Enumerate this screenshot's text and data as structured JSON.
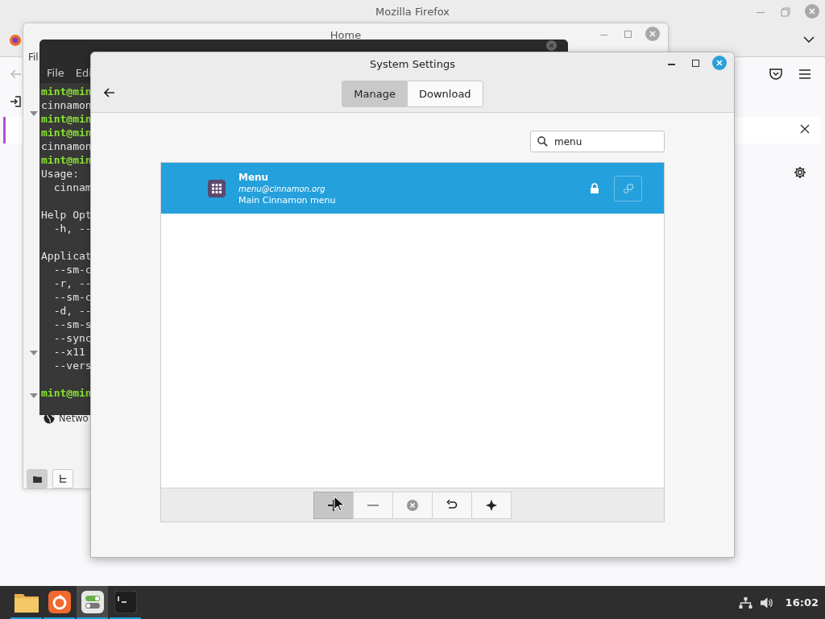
{
  "firefox": {
    "title": "Mozilla Firefox"
  },
  "files_window": {
    "title": "Home",
    "menu": [
      "Fil"
    ],
    "sidebar": [
      {
        "label": "Netwo"
      }
    ],
    "view_buttons": [
      {
        "kind": "icons",
        "selected": true
      },
      {
        "kind": "tree",
        "selected": false
      }
    ]
  },
  "terminal": {
    "menu": [
      "File",
      "Edi"
    ],
    "lines": [
      {
        "kind": "prompt",
        "text": "mint@min"
      },
      {
        "kind": "output",
        "text": "cinnamon"
      },
      {
        "kind": "prompt",
        "text": "mint@min"
      },
      {
        "kind": "prompt",
        "text": "mint@min"
      },
      {
        "kind": "output",
        "text": "cinnamon"
      },
      {
        "kind": "prompt",
        "text": "mint@min"
      },
      {
        "kind": "output",
        "text": "Usage:"
      },
      {
        "kind": "output",
        "text": "  cinnam"
      },
      {
        "kind": "blank"
      },
      {
        "kind": "output",
        "text": "Help Opt"
      },
      {
        "kind": "output",
        "text": "  -h, --"
      },
      {
        "kind": "blank"
      },
      {
        "kind": "output",
        "text": "Applicat"
      },
      {
        "kind": "output",
        "text": "  --sm-c"
      },
      {
        "kind": "output",
        "text": "  -r, --"
      },
      {
        "kind": "output",
        "text": "  --sm-c"
      },
      {
        "kind": "output",
        "text": "  -d, --"
      },
      {
        "kind": "output",
        "text": "  --sm-s"
      },
      {
        "kind": "output",
        "text": "  --sync"
      },
      {
        "kind": "output",
        "text": "  --x11"
      },
      {
        "kind": "output",
        "text": "  --vers"
      },
      {
        "kind": "blank"
      },
      {
        "kind": "prompt",
        "text": "mint@min"
      }
    ]
  },
  "settings": {
    "title": "System Settings",
    "tabs": [
      {
        "label": "Manage",
        "selected": true
      },
      {
        "label": "Download",
        "selected": false
      }
    ],
    "search": {
      "value": "menu"
    },
    "items": [
      {
        "name": "Menu",
        "uuid": "menu@cinnamon.org",
        "description": "Main Cinnamon menu",
        "selected": true
      }
    ],
    "toolbar": [
      {
        "kind": "add",
        "pressed": true
      },
      {
        "kind": "remove",
        "pressed": false
      },
      {
        "kind": "clear",
        "pressed": false
      },
      {
        "kind": "undo",
        "pressed": false
      },
      {
        "kind": "more",
        "pressed": false
      }
    ]
  },
  "taskbar": {
    "apps": [
      {
        "kind": "files",
        "active": false
      },
      {
        "kind": "firefox",
        "active": false
      },
      {
        "kind": "settings",
        "active": true
      },
      {
        "kind": "terminal",
        "active": false
      }
    ],
    "clock": "16:02"
  }
}
